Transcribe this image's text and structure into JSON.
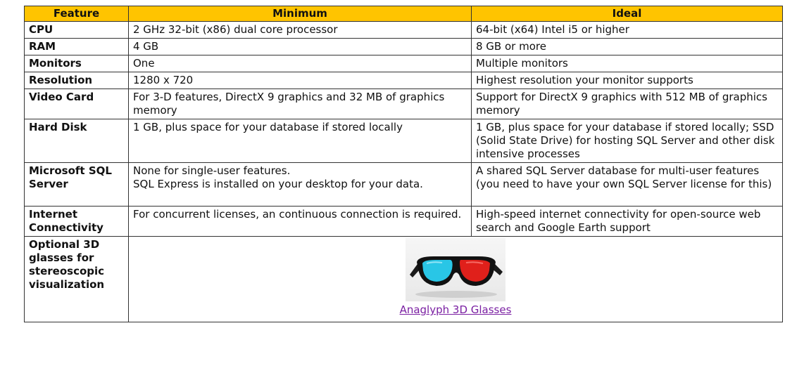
{
  "table": {
    "headers": [
      "Feature",
      "Minimum",
      "Ideal"
    ],
    "rows": [
      {
        "feature": "CPU",
        "minimum": "2 GHz 32-bit (x86) dual core processor",
        "ideal": "64-bit (x64) Intel i5 or higher"
      },
      {
        "feature": "RAM",
        "minimum": "4 GB",
        "ideal": "8 GB or more"
      },
      {
        "feature": "Monitors",
        "minimum": "One",
        "ideal": "Multiple monitors"
      },
      {
        "feature": "Resolution",
        "minimum": "1280 x 720",
        "ideal": "Highest resolution your monitor supports"
      },
      {
        "feature": "Video Card",
        "minimum": "For 3-D features, DirectX 9 graphics and 32 MB of graphics memory",
        "ideal": "Support for DirectX 9 graphics with 512 MB of graphics memory"
      },
      {
        "feature": "Hard Disk",
        "minimum": "1 GB, plus space for your database if stored locally",
        "ideal": "1 GB, plus space for your database if stored locally; SSD (Solid State Drive) for hosting SQL Server and other disk intensive processes"
      },
      {
        "feature": "Microsoft SQL Server",
        "minimum_lines": [
          "None for single-user features.",
          "SQL Express is installed on your desktop for your data."
        ],
        "ideal": "A shared SQL Server database for multi-user features (you need to have your own SQL Server license for this)"
      },
      {
        "feature": "Internet Connectivity",
        "minimum": "For concurrent licenses, an continuous connection is required.",
        "ideal": "High-speed internet connectivity for open-source web search and Google Earth support"
      },
      {
        "feature": "Optional 3D glasses for stereoscopic visualization",
        "image_icon": "anaglyph-3d-glasses-image",
        "link_text": "Anaglyph 3D Glasses"
      }
    ]
  },
  "colors": {
    "header_bg": "#ffc400",
    "border": "#333333",
    "link": "#7a1fa2",
    "lens_left": "#29c6e6",
    "lens_right": "#e0201b"
  }
}
